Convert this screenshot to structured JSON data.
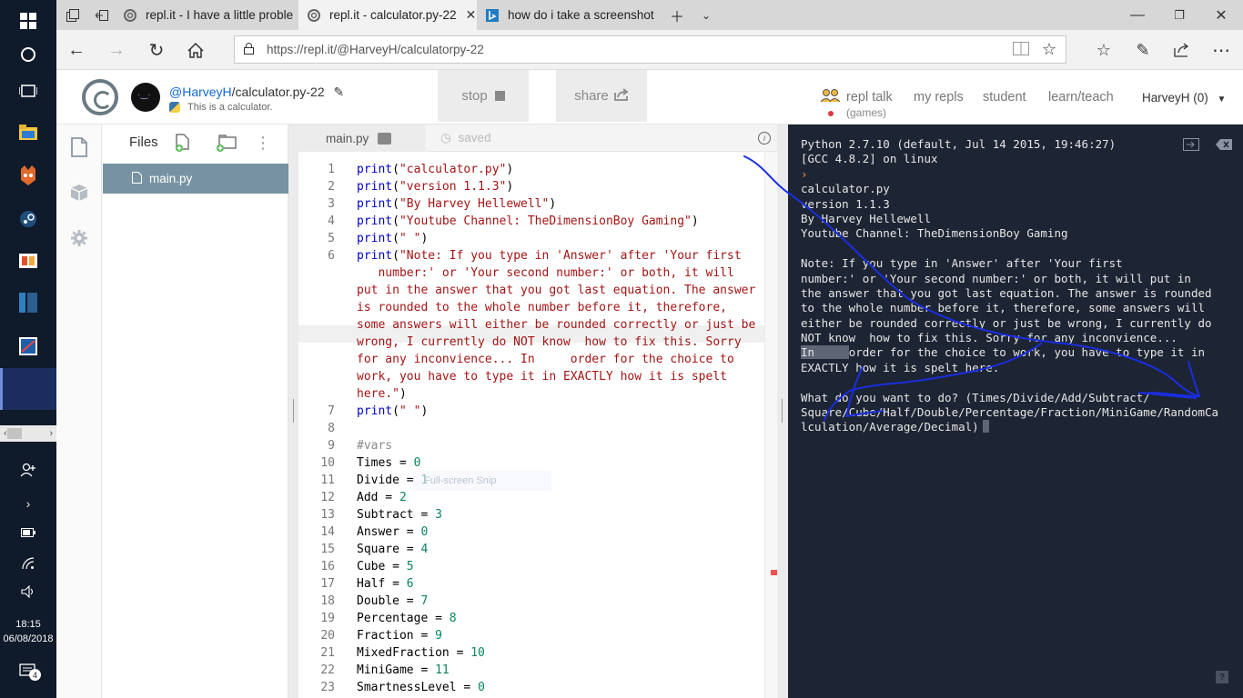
{
  "taskbar": {
    "clock_time": "18:15",
    "clock_date": "06/08/2018",
    "notification_count": "4"
  },
  "browser": {
    "tabs": [
      {
        "label": "repl.it - I have a little proble",
        "icon": "replit-icon"
      },
      {
        "label": "repl.it - calculator.py-22",
        "icon": "replit-icon",
        "active": true
      },
      {
        "label": "how do i take a screenshot",
        "icon": "bing-icon"
      }
    ],
    "url": "https://repl.it/@HarveyH/calculatorpy-22"
  },
  "repl": {
    "owner": "@HarveyH",
    "name": "/calculator.py-22",
    "description": "This is a calculator.",
    "stop_label": "stop",
    "share_label": "share",
    "nav": {
      "repl_talk": "repl talk",
      "games": "(games)",
      "my_repls": "my repls",
      "student": "student",
      "learn_teach": "learn/teach",
      "user": "HarveyH (0)"
    }
  },
  "files_panel": {
    "title": "Files",
    "files": [
      "main.py"
    ]
  },
  "editor": {
    "tab_label": "main.py",
    "status": "saved",
    "snip_hint": "Full-screen Snip",
    "lines": [
      {
        "n": "1",
        "parts": [
          {
            "t": "print",
            "c": "kw"
          },
          {
            "t": "(",
            "c": ""
          },
          {
            "t": "\"calculator.py\"",
            "c": "str"
          },
          {
            "t": ")",
            "c": ""
          }
        ]
      },
      {
        "n": "2",
        "parts": [
          {
            "t": "print",
            "c": "kw"
          },
          {
            "t": "(",
            "c": ""
          },
          {
            "t": "\"version 1.1.3\"",
            "c": "str"
          },
          {
            "t": ")",
            "c": ""
          }
        ]
      },
      {
        "n": "3",
        "parts": [
          {
            "t": "print",
            "c": "kw"
          },
          {
            "t": "(",
            "c": ""
          },
          {
            "t": "\"By Harvey Hellewell\"",
            "c": "str"
          },
          {
            "t": ")",
            "c": ""
          }
        ]
      },
      {
        "n": "4",
        "parts": [
          {
            "t": "print",
            "c": "kw"
          },
          {
            "t": "(",
            "c": ""
          },
          {
            "t": "\"Youtube Channel: TheDimensionBoy Gaming\"",
            "c": "str"
          },
          {
            "t": ")",
            "c": ""
          }
        ]
      },
      {
        "n": "5",
        "parts": [
          {
            "t": "print",
            "c": "kw"
          },
          {
            "t": "(",
            "c": ""
          },
          {
            "t": "\" \"",
            "c": "str"
          },
          {
            "t": ")",
            "c": ""
          }
        ]
      },
      {
        "n": "6",
        "parts": [
          {
            "t": "print",
            "c": "kw"
          },
          {
            "t": "(",
            "c": ""
          },
          {
            "t": "\"Note: If you type in 'Answer' after 'Your first",
            "c": "str"
          }
        ]
      },
      {
        "n": "",
        "parts": [
          {
            "t": "   number:' or 'Your second number:' or both, it will",
            "c": "str"
          }
        ]
      },
      {
        "n": "",
        "parts": [
          {
            "t": "put in the answer that you got last equation. The answer",
            "c": "str"
          }
        ]
      },
      {
        "n": "",
        "parts": [
          {
            "t": "is rounded to the whole number before it, therefore,",
            "c": "str"
          }
        ]
      },
      {
        "n": "",
        "parts": [
          {
            "t": "some answers will either be rounded correctly or just be",
            "c": "str"
          }
        ]
      },
      {
        "n": "",
        "parts": [
          {
            "t": "wrong, I currently do NOT know  how to fix this. Sorry",
            "c": "str"
          }
        ]
      },
      {
        "n": "",
        "parts": [
          {
            "t": "for any inconvience... In     order for the choice to",
            "c": "str"
          }
        ]
      },
      {
        "n": "",
        "parts": [
          {
            "t": "work, you have to type it in EXACTLY how it is spelt",
            "c": "str"
          }
        ]
      },
      {
        "n": "",
        "parts": [
          {
            "t": "here.\"",
            "c": "str"
          },
          {
            "t": ")",
            "c": ""
          }
        ]
      },
      {
        "n": "7",
        "parts": [
          {
            "t": "print",
            "c": "kw"
          },
          {
            "t": "(",
            "c": ""
          },
          {
            "t": "\" \"",
            "c": "str"
          },
          {
            "t": ")",
            "c": ""
          }
        ]
      },
      {
        "n": "8",
        "parts": []
      },
      {
        "n": "9",
        "parts": [
          {
            "t": "#vars",
            "c": "cm"
          }
        ]
      },
      {
        "n": "10",
        "parts": [
          {
            "t": "Times = ",
            "c": ""
          },
          {
            "t": "0",
            "c": "num"
          }
        ]
      },
      {
        "n": "11",
        "parts": [
          {
            "t": "Divide = ",
            "c": ""
          },
          {
            "t": "1",
            "c": "num"
          }
        ]
      },
      {
        "n": "12",
        "parts": [
          {
            "t": "Add = ",
            "c": ""
          },
          {
            "t": "2",
            "c": "num"
          }
        ]
      },
      {
        "n": "13",
        "parts": [
          {
            "t": "Subtract = ",
            "c": ""
          },
          {
            "t": "3",
            "c": "num"
          }
        ]
      },
      {
        "n": "14",
        "parts": [
          {
            "t": "Answer = ",
            "c": ""
          },
          {
            "t": "0",
            "c": "num"
          }
        ]
      },
      {
        "n": "15",
        "parts": [
          {
            "t": "Square = ",
            "c": ""
          },
          {
            "t": "4",
            "c": "num"
          }
        ]
      },
      {
        "n": "16",
        "parts": [
          {
            "t": "Cube = ",
            "c": ""
          },
          {
            "t": "5",
            "c": "num"
          }
        ]
      },
      {
        "n": "17",
        "parts": [
          {
            "t": "Half = ",
            "c": ""
          },
          {
            "t": "6",
            "c": "num"
          }
        ]
      },
      {
        "n": "18",
        "parts": [
          {
            "t": "Double = ",
            "c": ""
          },
          {
            "t": "7",
            "c": "num"
          }
        ]
      },
      {
        "n": "19",
        "parts": [
          {
            "t": "Percentage = ",
            "c": ""
          },
          {
            "t": "8",
            "c": "num"
          }
        ]
      },
      {
        "n": "20",
        "parts": [
          {
            "t": "Fraction = ",
            "c": ""
          },
          {
            "t": "9",
            "c": "num"
          }
        ]
      },
      {
        "n": "21",
        "parts": [
          {
            "t": "MixedFraction = ",
            "c": ""
          },
          {
            "t": "10",
            "c": "num"
          }
        ]
      },
      {
        "n": "22",
        "parts": [
          {
            "t": "MiniGame = ",
            "c": ""
          },
          {
            "t": "11",
            "c": "num"
          }
        ]
      },
      {
        "n": "23",
        "parts": [
          {
            "t": "SmartnessLevel = ",
            "c": ""
          },
          {
            "t": "0",
            "c": "num"
          }
        ]
      }
    ]
  },
  "console": {
    "lines": [
      {
        "t": "Python 2.7.10 (default, Jul 14 2015, 19:46:27)"
      },
      {
        "t": "[GCC 4.8.2] on linux"
      },
      {
        "t": "›",
        "c": "prompt"
      },
      {
        "t": "calculator.py"
      },
      {
        "t": "version 1.1.3"
      },
      {
        "t": "By Harvey Hellewell"
      },
      {
        "t": "Youtube Channel: TheDimensionBoy Gaming"
      },
      {
        "t": " "
      },
      {
        "t": "Note: If you type in 'Answer' after 'Your first"
      },
      {
        "t": "number:' or 'Your second number:' or both, it will put in"
      },
      {
        "t": "the answer that you got last equation. The answer is rounded"
      },
      {
        "t": "to the whole number before it, therefore, some answers will"
      },
      {
        "t": "either be rounded correctly or just be wrong, I currently do"
      },
      {
        "t": "NOT know  how to fix this. Sorry for any inconvience..."
      },
      {
        "sel": "In     ",
        "t": "order for the choice to work, you have to type it in"
      },
      {
        "t": "EXACTLY how it is spelt here."
      },
      {
        "t": " "
      },
      {
        "t": "What do you want to do? (Times/Divide/Add/Subtract/"
      },
      {
        "t": "Square/Cube/Half/Double/Percentage/Fraction/MiniGame/RandomCa"
      },
      {
        "t": "lculation/Average/Decimal)",
        "cursor": true
      }
    ],
    "help_label": "?"
  },
  "colors": {
    "console_bg": "#1d2433",
    "file_selected": "#7793a3",
    "annotation_pen": "#1a2ee0"
  }
}
